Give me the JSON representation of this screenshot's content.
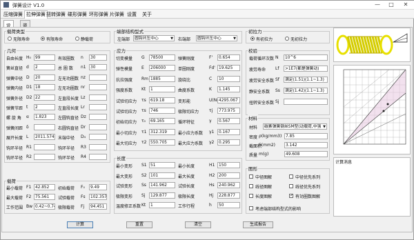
{
  "window": {
    "title": "弹簧设计 V1.0",
    "min": "—",
    "max": "□",
    "close": "✕"
  },
  "menu": [
    "压缩弹簧",
    "拉伸弹簧",
    "扭转弹簧",
    "碟形弹簧",
    "环形弹簧",
    "片弹簧",
    "设置",
    "关于"
  ],
  "subtabs": [
    "设计",
    "资料"
  ],
  "load_type": {
    "title": "载荷类型",
    "options": [
      "无限寿命",
      "有限寿命",
      "静载荷"
    ]
  },
  "end_structure": {
    "title": "端部结构型式",
    "left_label": "左端部",
    "left_value": "圆钩环压中心",
    "right_label": "右端部",
    "right_value": "圆钩环压中心"
  },
  "initial_force": {
    "title": "初拉力",
    "options": [
      "有初拉力",
      "无初拉力"
    ]
  },
  "geometry": {
    "title": "几何",
    "rows": [
      {
        "l1": "自由长度",
        "s1": "H₀",
        "v1": "99",
        "l2": "有效圈数",
        "s2": "n",
        "v2": "30"
      },
      {
        "l1": "簧丝直径",
        "s1": "d",
        "v1": "2",
        "l2": "总 圈 数",
        "s2": "n1",
        "v2": "30"
      },
      {
        "l1": "弹簧中径",
        "s1": "D",
        "v1": "20",
        "l2": "左无功圈数",
        "s2": "nz",
        "v2": ""
      },
      {
        "l1": "弹簧内径",
        "s1": "D1",
        "v1": "18",
        "l2": "左无功圈数",
        "s2": "nr",
        "v2": ""
      },
      {
        "l1": "弹簧外径",
        "s1": "D2",
        "v1": "22",
        "l2": "左直段长度",
        "s2": "Lz",
        "v2": ""
      },
      {
        "l1": "弹簧节距",
        "s1": "t",
        "v1": "2",
        "l2": "左直段长度",
        "s2": "Lr",
        "v2": ""
      },
      {
        "l1": "螺 旋 角",
        "s1": "α",
        "v1": "1.823",
        "l2": "左圆钩直径",
        "s2": "Dz",
        "v2": ""
      },
      {
        "l1": "弹簧间距",
        "s1": "δ",
        "v1": "",
        "l2": "右圆钩直径",
        "s2": "Dr",
        "v2": ""
      },
      {
        "l1": "展开长度",
        "s1": "L",
        "v1": "2011.574",
        "l2": "末端中径",
        "s2": "D₄",
        "v2": ""
      },
      {
        "l1": "钩环半径",
        "s1": "R1",
        "v1": "",
        "l2": "钩环半径",
        "s2": "R3",
        "v2": ""
      },
      {
        "l1": "钩环半径",
        "s1": "R2",
        "v1": "",
        "l2": "钩环半径",
        "s2": "R4",
        "v2": ""
      }
    ]
  },
  "load": {
    "title": "载荷",
    "rows": [
      {
        "l1": "最小载荷",
        "s1": "F1",
        "v1": "42.852",
        "l2": "初始载荷",
        "s2": "F₀",
        "v2": "9.49"
      },
      {
        "l1": "最大载荷",
        "s1": "F2",
        "v1": "75.561",
        "l2": "试验载荷",
        "s2": "Fs",
        "v2": "102.357"
      },
      {
        "l1": "工作范围",
        "s1": "Bw",
        "v1": "0.42~0.74",
        "l2": "极限载荷",
        "s2": "Fj",
        "v2": "94.451"
      }
    ]
  },
  "stress": {
    "title": "应力",
    "rows": [
      {
        "l1": "切变模量",
        "s1": "G",
        "v1": "78500",
        "l2": "弹簧刚度",
        "s2": "F'",
        "v2": "0.654"
      },
      {
        "l1": "弹性模量",
        "s1": "E",
        "v1": "206000",
        "l2": "单圈刚度",
        "s2": "Fd'",
        "v2": "19.625"
      },
      {
        "l1": "抗拉强度",
        "s1": "Rm",
        "v1": "1885",
        "l2": "旋绕比",
        "s2": "C",
        "v2": "10"
      },
      {
        "l1": "强度系数",
        "s1": "Kt",
        "v1": "1",
        "l2": "曲度系数",
        "s2": "K",
        "v2": "1.145"
      },
      {
        "l1": "试验切应力",
        "s1": "τs",
        "v1": "619.18",
        "l2": "变形能",
        "s2": "U(Nmm)",
        "v2": "4295.067"
      },
      {
        "l1": "试验切应力",
        "s1": "τs",
        "v1": "746",
        "l2": "极限切应力",
        "s2": "τj",
        "v2": "773.975"
      },
      {
        "l1": "初始切应力",
        "s1": "τ₀",
        "v1": "69.165",
        "l2": "循环特征",
        "s2": "γ",
        "v2": "0.567"
      },
      {
        "l1": "最小切应力",
        "s1": "τ1",
        "v1": "312.319",
        "l2": "最小应力系数",
        "s2": "γ1",
        "v2": "0.167"
      },
      {
        "l1": "最大切应力",
        "s1": "τ2",
        "v1": "550.705",
        "l2": "最大应力系数",
        "s2": "γ2",
        "v2": "0.295"
      }
    ]
  },
  "length": {
    "title": "长度",
    "rows": [
      {
        "l1": "最小变形",
        "s1": "S1",
        "v1": "51",
        "l2": "最小长度",
        "s2": "H1",
        "v2": "150"
      },
      {
        "l1": "最大变形",
        "s1": "S2",
        "v1": "101",
        "l2": "最大长度",
        "s2": "H2",
        "v2": "200"
      },
      {
        "l1": "试验变形",
        "s1": "Ss",
        "v1": "141.962",
        "l2": "试验长度",
        "s2": "Hs",
        "v2": "240.962"
      },
      {
        "l1": "极限变形",
        "s1": "Sj",
        "v1": "129.877",
        "l2": "极限长度",
        "s2": "Hj",
        "v2": "228.877"
      },
      {
        "l1": "温度修正系数",
        "s1": "Kt",
        "v1": "1",
        "l2": "工作行程",
        "s2": "h",
        "v2": "50"
      }
    ]
  },
  "check": {
    "title": "校验",
    "rows": [
      {
        "label": "载荷循环次数",
        "sym": "N",
        "value": "10^6"
      },
      {
        "label": "疲劳寿命",
        "sym": "Lf",
        "value": ">1E7(都是弹簧动)"
      },
      {
        "label": "疲劳安全系数",
        "sym": "Sf",
        "value": "满足(1.51)(1.1~1.3)"
      },
      {
        "label": "静安全系数",
        "sym": "Ss",
        "value": "满足(1.42)(1.1~1.3)"
      },
      {
        "label": "扭转安全系数",
        "sym": "Sj",
        "value": ""
      }
    ]
  },
  "material": {
    "title": "材料",
    "name_label": "材料",
    "name_value": "碳素弹簧钢丝SM型(动载荷,中强",
    "rows": [
      {
        "label": "密度",
        "sym": "ρ(kg/mm3)",
        "value": "7.85"
      },
      {
        "label": "截面积",
        "sym": "S(mm2)",
        "value": "3.142"
      },
      {
        "label": "质量",
        "sym": "m(g)",
        "value": "49.608"
      }
    ]
  },
  "diagram": {
    "title": "图形",
    "items": [
      {
        "label": "中径图解",
        "checked": false
      },
      {
        "label": "中径优先系列",
        "checked": false
      },
      {
        "label": "线径图解",
        "checked": false
      },
      {
        "label": "线径优先系列",
        "checked": false
      },
      {
        "label": "长度图解",
        "checked": false
      },
      {
        "label": "有効圈数图解",
        "checked": true
      }
    ],
    "last_label": "考虑端部结构型式的影响",
    "last_checked": false
  },
  "calc_msg": {
    "title": "计算消息"
  },
  "buttons": [
    "计算",
    "重置",
    "清空",
    "生成报告"
  ],
  "colors": {
    "spring": "#e8e000",
    "spring_shade": "#b8a800",
    "grid": "#555555"
  }
}
